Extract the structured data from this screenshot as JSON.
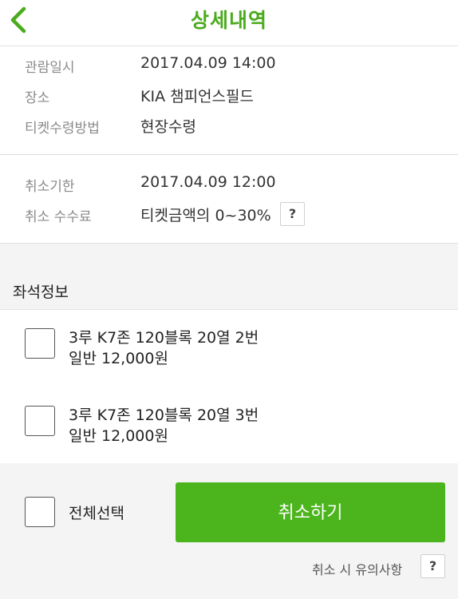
{
  "header": {
    "title": "상세내역",
    "back_icon": "chevron-left-icon"
  },
  "booking_info": [
    {
      "label": "관람일시",
      "value": "2017.04.09 14:00"
    },
    {
      "label": "장소",
      "value": "KIA 챔피언스필드"
    },
    {
      "label": "티켓수령방법",
      "value": "현장수령"
    }
  ],
  "cancel_info": {
    "deadline_label": "취소기한",
    "deadline_value": "2017.04.09 12:00",
    "fee_label": "취소 수수료",
    "fee_value": "티켓금액의 0~30%",
    "fee_help": "?"
  },
  "seat_section": {
    "title": "좌석정보",
    "seats": [
      {
        "line1": "3루 K7존 120블록 20열 2번",
        "line2": "일반 12,000원",
        "checked": false
      },
      {
        "line1": "3루 K7존 120블록 20열 3번",
        "line2": "일반 12,000원",
        "checked": false
      }
    ]
  },
  "actions": {
    "select_all_label": "전체선택",
    "cancel_button_label": "취소하기",
    "notice_label": "취소 시 유의사항",
    "notice_help": "?"
  },
  "colors": {
    "brand_green": "#4cb51d",
    "title_green": "#4aab1c"
  }
}
